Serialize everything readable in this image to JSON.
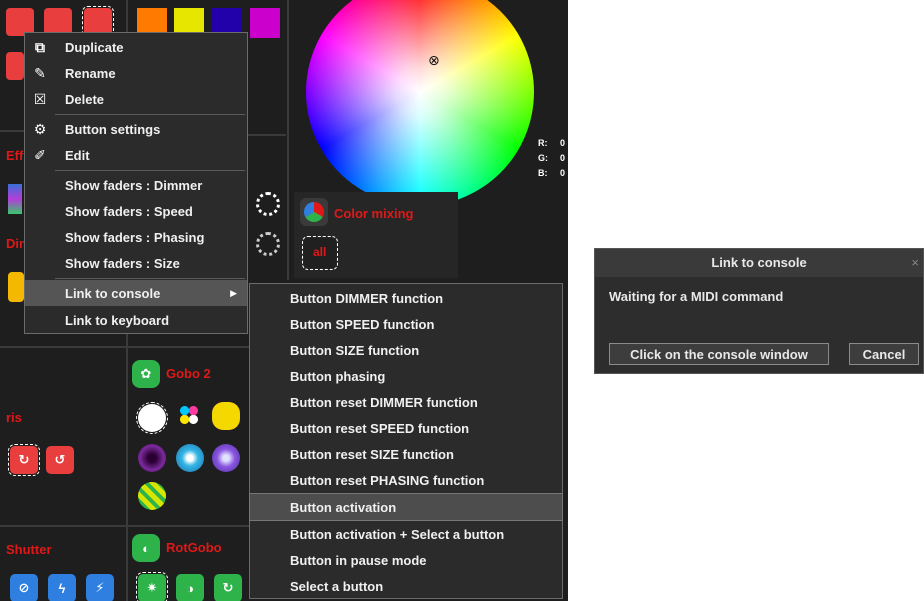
{
  "colors": {
    "swatches": [
      "#ff7a00",
      "#e6e600",
      "#2200aa",
      "#cc00cc"
    ],
    "accent_red": "#e01818"
  },
  "sections": {
    "eff": "Eff",
    "dim": "Dim",
    "iris": "ris",
    "shutter": "Shutter",
    "gobo2": "Gobo 2",
    "rotgobo": "RotGobo",
    "color_mixing": "Color mixing",
    "all_button": "all"
  },
  "rgb": {
    "r_label": "R:",
    "r_value": "0",
    "g_label": "G:",
    "g_value": "0",
    "b_label": "B:",
    "b_value": "0"
  },
  "context_menu": {
    "items": [
      {
        "label": "Duplicate",
        "icon": "duplicate-icon",
        "glyph": "⧉"
      },
      {
        "label": "Rename",
        "icon": "rename-icon",
        "glyph": "✎"
      },
      {
        "label": "Delete",
        "icon": "delete-icon",
        "glyph": "☒"
      },
      {
        "label": "Button settings",
        "icon": "gear-icon",
        "glyph": "⚙"
      },
      {
        "label": "Edit",
        "icon": "edit-icon",
        "glyph": "✐"
      },
      {
        "label": "Show faders : Dimmer"
      },
      {
        "label": "Show faders : Speed"
      },
      {
        "label": "Show faders : Phasing"
      },
      {
        "label": "Show faders : Size"
      },
      {
        "label": "Link to console",
        "has_submenu": true
      },
      {
        "label": "Link to keyboard"
      }
    ]
  },
  "submenu": {
    "items": [
      "Button DIMMER function",
      "Button SPEED function",
      "Button SIZE function",
      "Button phasing",
      "Button reset DIMMER function",
      "Button reset SPEED function",
      "Button reset SIZE function",
      "Button reset PHASING function",
      "Button activation",
      "Button activation + Select a button",
      "Button in pause mode",
      "Select a button"
    ],
    "active_index": 8
  },
  "dialog": {
    "title": "Link to console",
    "close_glyph": "×",
    "message": "Waiting for a MIDI command",
    "primary_button": "Click on the console window",
    "cancel_button": "Cancel"
  }
}
